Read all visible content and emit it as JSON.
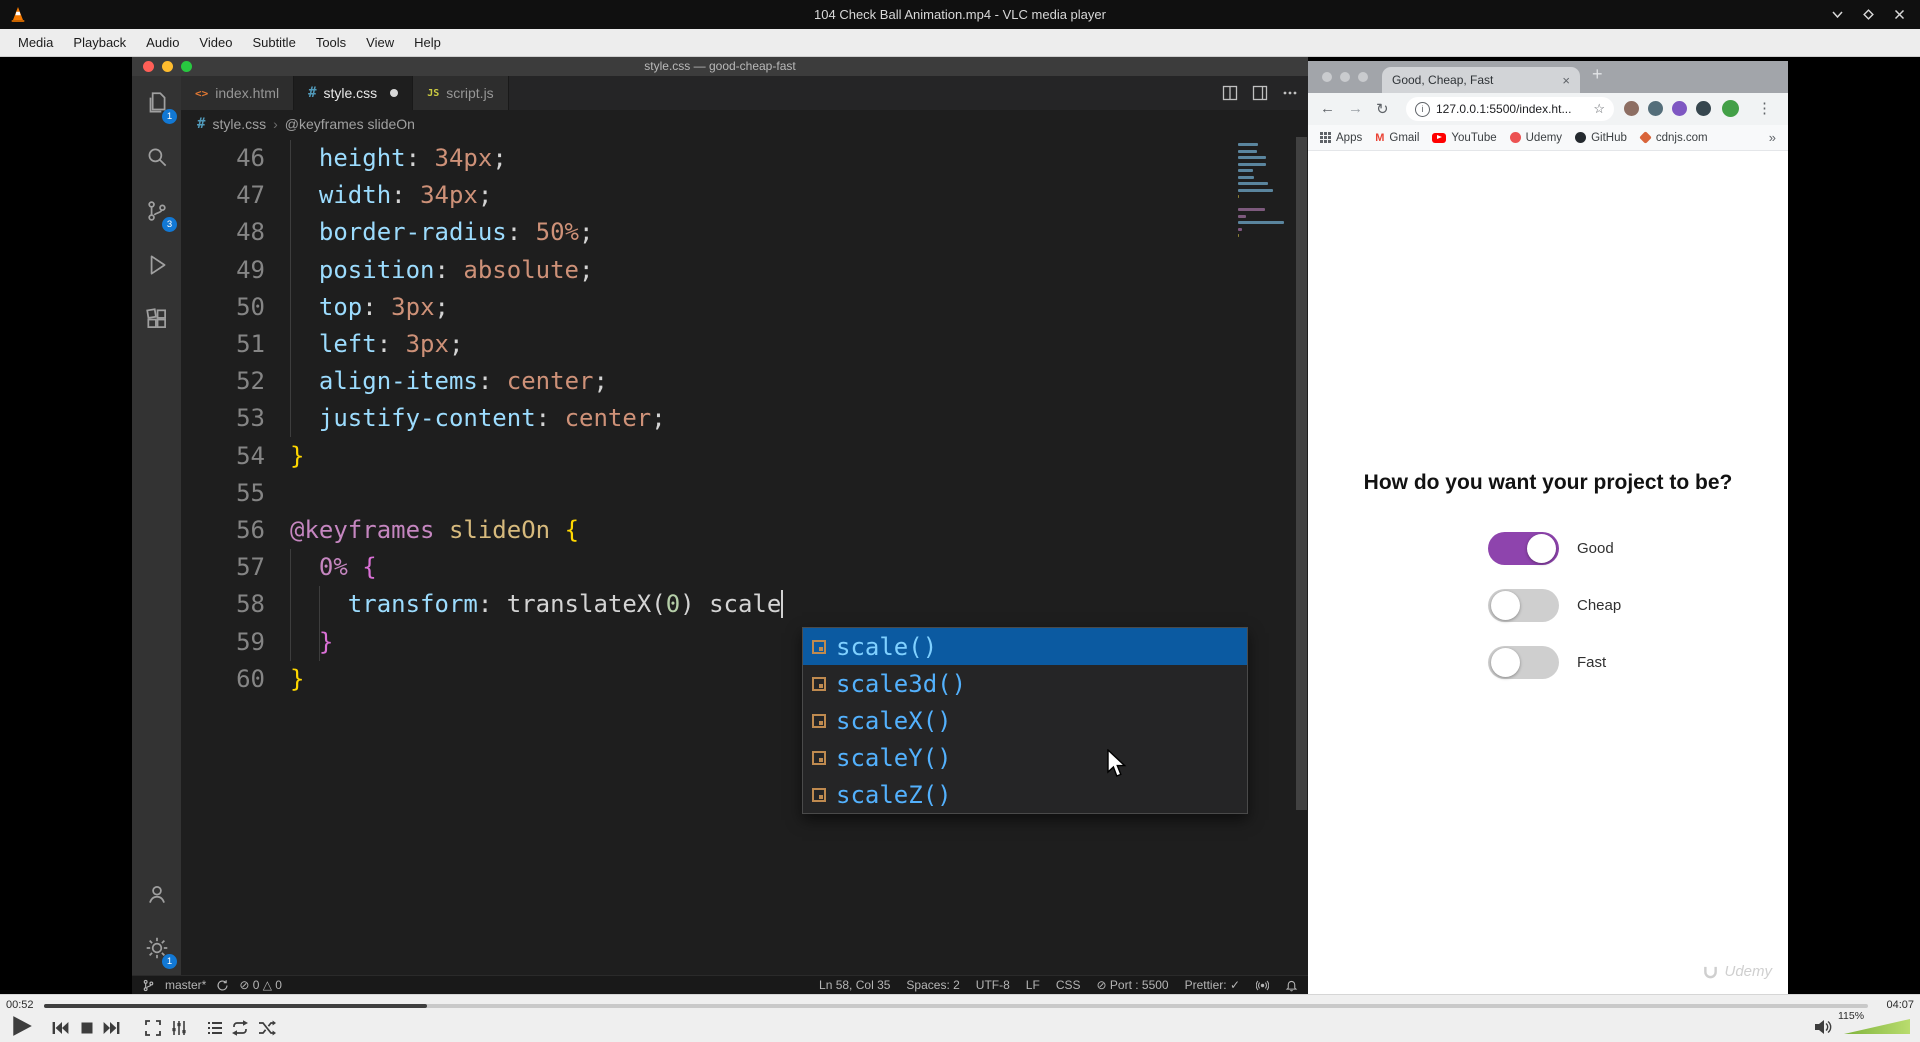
{
  "vlc": {
    "window_title": "104 Check Ball Animation.mp4 - VLC media player",
    "menu": [
      "Media",
      "Playback",
      "Audio",
      "Video",
      "Subtitle",
      "Tools",
      "View",
      "Help"
    ],
    "elapsed": "00:52",
    "duration": "04:07",
    "progress_percent": 21,
    "volume": "115%"
  },
  "vscode": {
    "window_title": "style.css — good-cheap-fast",
    "tabs": [
      {
        "label": "index.html",
        "icon": "html",
        "active": false,
        "modified": false
      },
      {
        "label": "style.css",
        "icon": "css",
        "active": true,
        "modified": true
      },
      {
        "label": "script.js",
        "icon": "js",
        "active": false,
        "modified": false
      }
    ],
    "breadcrumb": {
      "file": "style.css",
      "symbol": "@keyframes slideOn"
    },
    "code": {
      "lines": [
        {
          "n": 46,
          "tokens": [
            [
              "  ",
              "pl"
            ],
            [
              "height",
              "prop"
            ],
            [
              ": ",
              "pl"
            ],
            [
              "34px",
              "val"
            ],
            [
              ";",
              "pl"
            ]
          ]
        },
        {
          "n": 47,
          "tokens": [
            [
              "  ",
              "pl"
            ],
            [
              "width",
              "prop"
            ],
            [
              ": ",
              "pl"
            ],
            [
              "34px",
              "val"
            ],
            [
              ";",
              "pl"
            ]
          ]
        },
        {
          "n": 48,
          "tokens": [
            [
              "  ",
              "pl"
            ],
            [
              "border-radius",
              "prop"
            ],
            [
              ": ",
              "pl"
            ],
            [
              "50%",
              "val"
            ],
            [
              ";",
              "pl"
            ]
          ]
        },
        {
          "n": 49,
          "tokens": [
            [
              "  ",
              "pl"
            ],
            [
              "position",
              "prop"
            ],
            [
              ": ",
              "pl"
            ],
            [
              "absolute",
              "val"
            ],
            [
              ";",
              "pl"
            ]
          ]
        },
        {
          "n": 50,
          "tokens": [
            [
              "  ",
              "pl"
            ],
            [
              "top",
              "prop"
            ],
            [
              ": ",
              "pl"
            ],
            [
              "3px",
              "val"
            ],
            [
              ";",
              "pl"
            ]
          ]
        },
        {
          "n": 51,
          "tokens": [
            [
              "  ",
              "pl"
            ],
            [
              "left",
              "prop"
            ],
            [
              ": ",
              "pl"
            ],
            [
              "3px",
              "val"
            ],
            [
              ";",
              "pl"
            ]
          ]
        },
        {
          "n": 52,
          "tokens": [
            [
              "  ",
              "pl"
            ],
            [
              "align-items",
              "prop"
            ],
            [
              ": ",
              "pl"
            ],
            [
              "center",
              "val"
            ],
            [
              ";",
              "pl"
            ]
          ]
        },
        {
          "n": 53,
          "tokens": [
            [
              "  ",
              "pl"
            ],
            [
              "justify-content",
              "prop"
            ],
            [
              ": ",
              "pl"
            ],
            [
              "center",
              "val"
            ],
            [
              ";",
              "pl"
            ]
          ]
        },
        {
          "n": 54,
          "tokens": [
            [
              "}",
              "b1"
            ]
          ]
        },
        {
          "n": 55,
          "tokens": []
        },
        {
          "n": 56,
          "tokens": [
            [
              "@keyframes",
              "kw"
            ],
            [
              " ",
              "pl"
            ],
            [
              "slideOn",
              "name"
            ],
            [
              " ",
              "pl"
            ],
            [
              "{",
              "b1"
            ]
          ]
        },
        {
          "n": 57,
          "tokens": [
            [
              "  ",
              "pl"
            ],
            [
              "0%",
              "kw"
            ],
            [
              " ",
              "pl"
            ],
            [
              "{",
              "b2"
            ]
          ]
        },
        {
          "n": 58,
          "tokens": [
            [
              "    ",
              "pl"
            ],
            [
              "transform",
              "prop"
            ],
            [
              ": ",
              "pl"
            ],
            [
              "translateX",
              "pl"
            ],
            [
              "(",
              "pl"
            ],
            [
              "0",
              "num"
            ],
            [
              ")",
              "pl"
            ],
            [
              " ",
              "pl"
            ],
            [
              "scale",
              "pl"
            ]
          ]
        },
        {
          "n": 59,
          "tokens": [
            [
              "  ",
              "pl"
            ],
            [
              "}",
              "b2"
            ]
          ]
        },
        {
          "n": 60,
          "tokens": [
            [
              "}",
              "b1"
            ]
          ]
        }
      ]
    },
    "suggest": {
      "selected_index": 0,
      "items": [
        "scale()",
        "scale3d()",
        "scaleX()",
        "scaleY()",
        "scaleZ()"
      ]
    },
    "status_left": {
      "branch": "master*",
      "problems": "⊘ 0  △ 0"
    },
    "status_right": [
      "Ln 58, Col 35",
      "Spaces: 2",
      "UTF-8",
      "LF",
      "CSS",
      "⊘ Port : 5500",
      "Prettier: ✓"
    ],
    "badges": {
      "explorer": "1",
      "source_control": "3",
      "settings": "1"
    }
  },
  "browser": {
    "tab_title": "Good, Cheap, Fast",
    "url": "127.0.0.1:5500/index.ht...",
    "bookmarks": [
      {
        "label": "Apps",
        "icon": "apps"
      },
      {
        "label": "Gmail",
        "icon": "gmail"
      },
      {
        "label": "YouTube",
        "icon": "youtube"
      },
      {
        "label": "Udemy",
        "icon": "udemy"
      },
      {
        "label": "GitHub",
        "icon": "github"
      },
      {
        "label": "cdnjs.com",
        "icon": "cdnjs"
      }
    ],
    "page": {
      "heading": "How do you want your project to be?",
      "accent_color": "#8e44ad",
      "toggles": [
        {
          "label": "Good",
          "on": true
        },
        {
          "label": "Cheap",
          "on": false
        },
        {
          "label": "Fast",
          "on": false
        }
      ],
      "watermark": "Udemy"
    }
  }
}
